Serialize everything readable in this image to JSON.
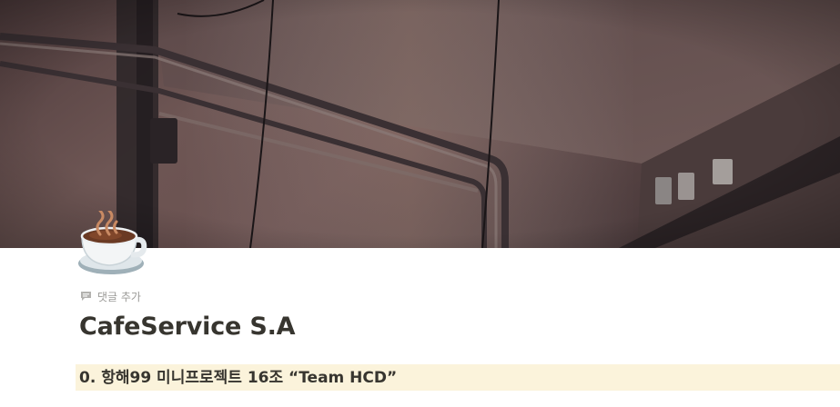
{
  "cover": {
    "description_icon": "cafe-interior-cover-image"
  },
  "page_icon": {
    "icon": "hot-beverage-icon"
  },
  "comment": {
    "icon": "comment-icon",
    "label": "댓글 추가"
  },
  "page": {
    "title": "CafeService S.A"
  },
  "callout": {
    "text": "0. 항해99 미니프로젝트 16조 “Team HCD”",
    "background": "#fbf3db"
  },
  "colors": {
    "text": "#37352f",
    "muted": "#9b9a97"
  }
}
